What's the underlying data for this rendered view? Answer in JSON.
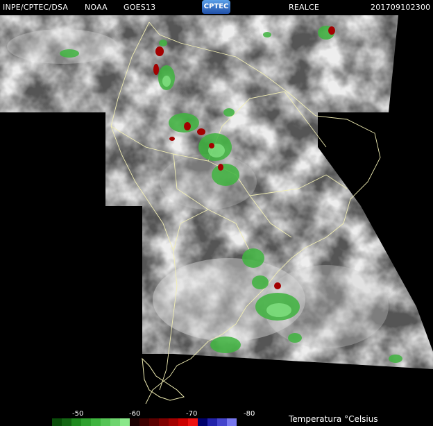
{
  "header": {
    "source": "INPE/CPTEC/DSA",
    "agency": "NOAA",
    "satellite": "GOES13",
    "logo": "CPTEC",
    "mode": "REALCE",
    "timestamp": "201709102300"
  },
  "legend": {
    "ticks": [
      "-50",
      "-60",
      "-70",
      "-80"
    ],
    "unit_label": "Temperatura  °Celsius",
    "colors": [
      "#0a4d0a",
      "#146614",
      "#1f8a1f",
      "#2fa02f",
      "#3fb43f",
      "#55c455",
      "#6ed46e",
      "#8ae88a",
      "#1a0000",
      "#3d0000",
      "#5c0000",
      "#800000",
      "#a30000",
      "#cc0000",
      "#ee1111",
      "#00006b",
      "#2222aa",
      "#4444cc",
      "#7777ee"
    ]
  },
  "icons": {
    "logo": "cptec-logo"
  }
}
